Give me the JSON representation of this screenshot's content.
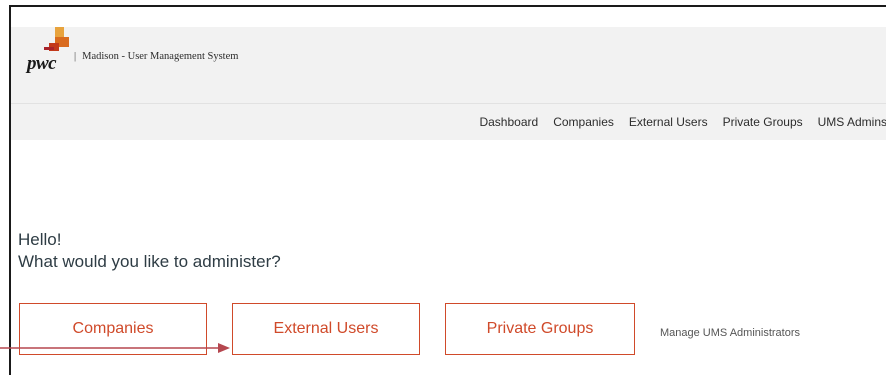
{
  "brand": {
    "logo_text": "pwc",
    "separator": "|",
    "app_title": "Madison - User Management System"
  },
  "nav": {
    "items": [
      "Dashboard",
      "Companies",
      "External Users",
      "Private Groups",
      "UMS Admins"
    ]
  },
  "greeting": {
    "hello": "Hello!",
    "prompt": "What would you like to administer?"
  },
  "tiles": {
    "companies": "Companies",
    "external_users": "External Users",
    "private_groups": "Private Groups"
  },
  "manage_link": "Manage UMS Administrators",
  "colors": {
    "accent": "#d04a2a",
    "header_bg": "#f2f2f2",
    "text_dark": "#2e3c44",
    "annotation_arrow": "#b5474f"
  },
  "icons": [
    "pwc-logo-icon",
    "annotation-arrow-icon"
  ]
}
